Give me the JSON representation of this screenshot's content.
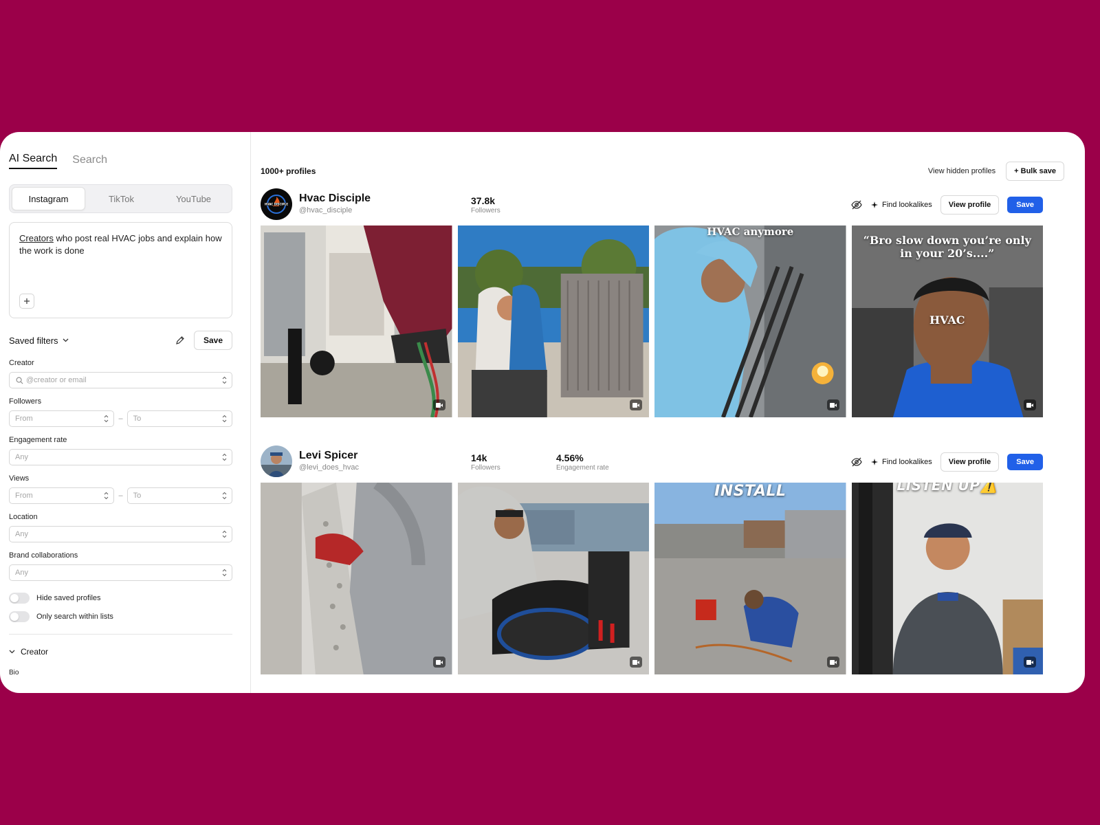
{
  "sidebar": {
    "tabs": [
      {
        "label": "AI Search",
        "active": true
      },
      {
        "label": "Search",
        "active": false
      }
    ],
    "platforms": [
      {
        "label": "Instagram",
        "active": true
      },
      {
        "label": "TikTok",
        "active": false
      },
      {
        "label": "YouTube",
        "active": false
      }
    ],
    "prompt": {
      "highlight": "Creators",
      "rest": " who post real HVAC jobs and explain how the work is done"
    },
    "saved_filters_label": "Saved filters",
    "save_label": "Save",
    "filters": {
      "creator": {
        "label": "Creator",
        "placeholder": "@creator or email"
      },
      "followers": {
        "label": "Followers",
        "from": "From",
        "to": "To"
      },
      "engagement": {
        "label": "Engagement rate",
        "value": "Any"
      },
      "views": {
        "label": "Views",
        "from": "From",
        "to": "To"
      },
      "location": {
        "label": "Location",
        "value": "Any"
      },
      "brand": {
        "label": "Brand collaborations",
        "value": "Any"
      }
    },
    "toggles": {
      "hide_saved": "Hide saved profiles",
      "only_lists": "Only search within lists"
    },
    "creator_section": "Creator",
    "bio_label": "Bio"
  },
  "main": {
    "count": "1000+ profiles",
    "view_hidden": "View hidden profiles",
    "bulk_save": "+ Bulk save",
    "find_lookalikes": "Find lookalikes",
    "view_profile": "View profile",
    "save": "Save",
    "profiles": [
      {
        "name": "Hvac Disciple",
        "handle": "@hvac_disciple",
        "followers_value": "37.8k",
        "followers_label": "Followers",
        "thumb_captions": [
          "",
          "",
          "HVAC anymore",
          "“Bro slow down you’re only in your 20’s....”",
          "HVAC"
        ]
      },
      {
        "name": "Levi Spicer",
        "handle": "@levi_does_hvac",
        "followers_value": "14k",
        "followers_label": "Followers",
        "engagement_value": "4.56%",
        "engagement_label": "Engagement rate",
        "thumb_captions": [
          "",
          "",
          "INSTALL",
          "LISTEN UP⚠️"
        ]
      }
    ]
  },
  "colors": {
    "background": "#9b0049",
    "accent_blue": "#2160e8"
  }
}
